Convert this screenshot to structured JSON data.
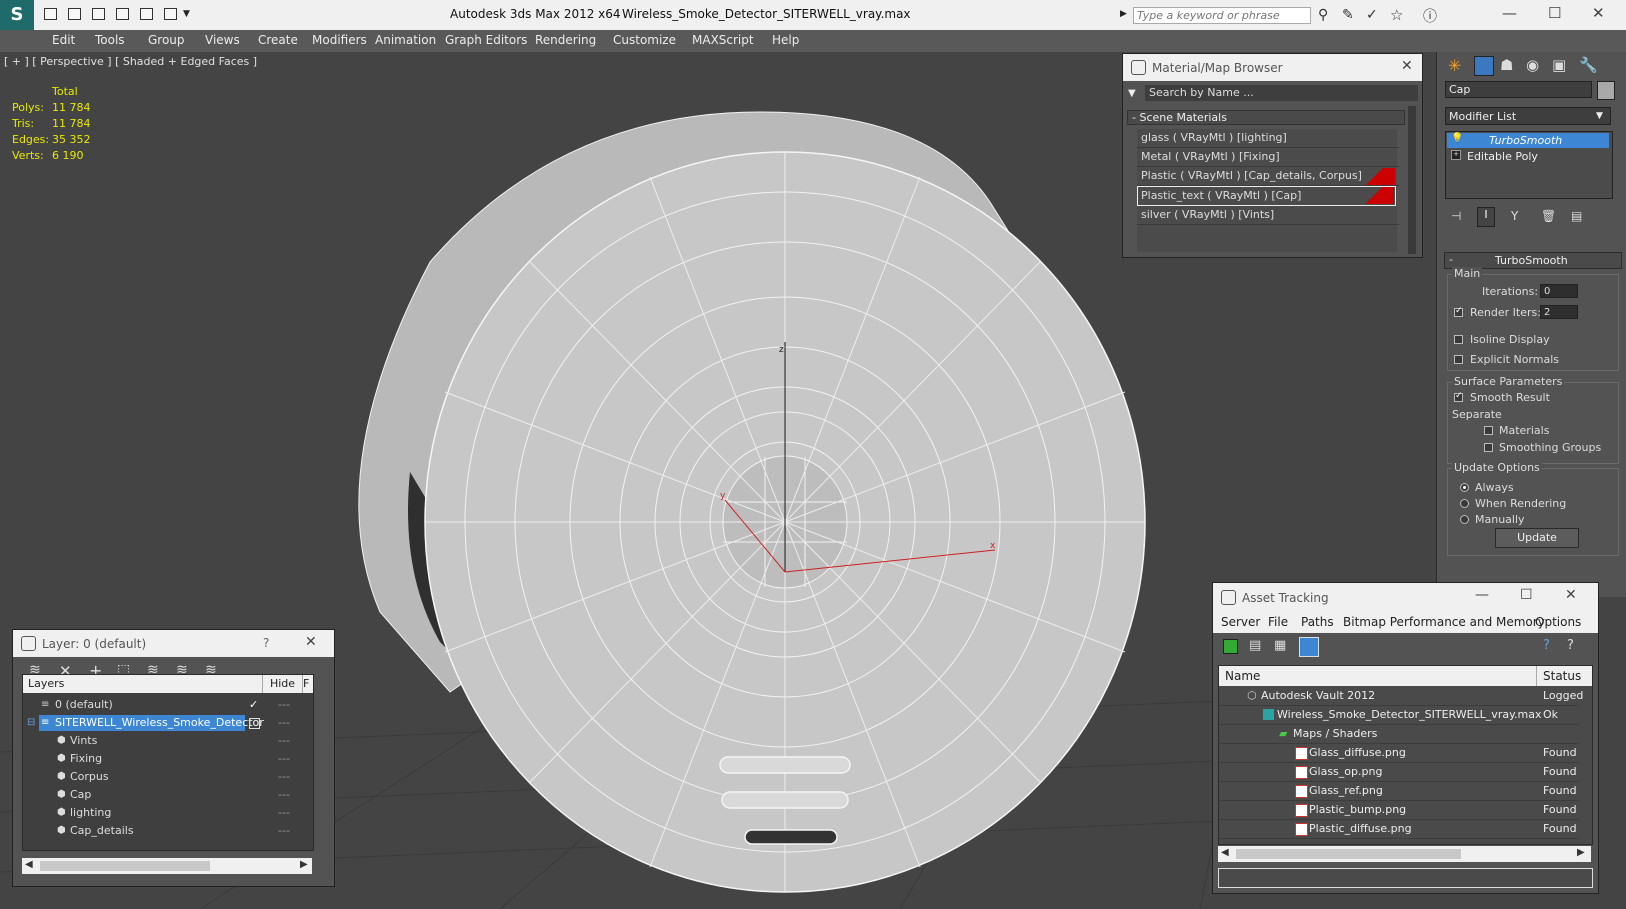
{
  "titlebar": {
    "app_title": "Autodesk 3ds Max  2012 x64",
    "file_name": "Wireless_Smoke_Detector_SITERWELL_vray.max",
    "search_placeholder": "Type a keyword or phrase",
    "minimize": "—",
    "maximize": "☐",
    "close": "✕"
  },
  "menu": [
    "Edit",
    "Tools",
    "Group",
    "Views",
    "Create",
    "Modifiers",
    "Animation",
    "Graph Editors",
    "Rendering",
    "Customize",
    "MAXScript",
    "Help"
  ],
  "viewport": {
    "label": "[ + ] [ Perspective ] [ Shaded + Edged Faces ]",
    "stats": {
      "header": "Total",
      "polys_label": "Polys:",
      "polys": "11 784",
      "tris_label": "Tris:",
      "tris": "11 784",
      "edges_label": "Edges:",
      "edges": "35 352",
      "verts_label": "Verts:",
      "verts": "6 190"
    },
    "gizmo": {
      "x": "x",
      "y": "y",
      "z": "z"
    }
  },
  "material_browser": {
    "title": "Material/Map Browser",
    "search_placeholder": "Search by Name ...",
    "section": "Scene Materials",
    "items": [
      {
        "label": "glass  ( VRayMtl ) [lighting]",
        "swatch": ""
      },
      {
        "label": "Metal  ( VRayMtl ) [Fixing]",
        "swatch": ""
      },
      {
        "label": "Plastic  ( VRayMtl ) [Cap_details, Corpus]",
        "swatch": "#cc0000"
      },
      {
        "label": "Plastic_text  ( VRayMtl ) [Cap]",
        "swatch": "#cc0000"
      },
      {
        "label": "silver  ( VRayMtl ) [Vints]",
        "swatch": ""
      }
    ]
  },
  "command_panel": {
    "object_name": "Cap",
    "modifier_list": "Modifier List",
    "stack": [
      "TurboSmooth",
      "Editable Poly"
    ],
    "rollout_title": "TurboSmooth",
    "main_group": "Main",
    "iterations_label": "Iterations:",
    "iterations": "0",
    "render_iters_label": "Render Iters:",
    "render_iters": "2",
    "isoline": "Isoline Display",
    "explicit_normals": "Explicit Normals",
    "surface_group": "Surface Parameters",
    "smooth_result": "Smooth Result",
    "separate": "Separate",
    "materials": "Materials",
    "smoothing_groups": "Smoothing Groups",
    "update_group": "Update Options",
    "always": "Always",
    "when_rendering": "When Rendering",
    "manually": "Manually",
    "update_btn": "Update"
  },
  "layer_panel": {
    "title": "Layer: 0 (default)",
    "help": "?",
    "close": "✕",
    "col_layers": "Layers",
    "col_hide": "Hide",
    "col_f": "F",
    "items": [
      {
        "label": "0 (default)",
        "indent": 1,
        "selected": false,
        "check": true
      },
      {
        "label": "SITERWELL_Wireless_Smoke_Detector",
        "indent": 1,
        "selected": true,
        "check": false
      },
      {
        "label": "Vints",
        "indent": 2,
        "selected": false,
        "check": false
      },
      {
        "label": "Fixing",
        "indent": 2,
        "selected": false,
        "check": false
      },
      {
        "label": "Corpus",
        "indent": 2,
        "selected": false,
        "check": false
      },
      {
        "label": "Cap",
        "indent": 2,
        "selected": false,
        "check": false
      },
      {
        "label": "lighting",
        "indent": 2,
        "selected": false,
        "check": false
      },
      {
        "label": "Cap_details",
        "indent": 2,
        "selected": false,
        "check": false
      }
    ]
  },
  "asset_tracking": {
    "title": "Asset Tracking",
    "menu": [
      "Server",
      "File",
      "Paths",
      "Bitmap Performance and Memory",
      "Options"
    ],
    "col_name": "Name",
    "col_status": "Status",
    "rows": [
      {
        "name": "Autodesk Vault 2012",
        "status": "Logged",
        "indent": 0
      },
      {
        "name": "Wireless_Smoke_Detector_SITERWELL_vray.max",
        "status": "Ok",
        "indent": 1
      },
      {
        "name": "Maps / Shaders",
        "status": "",
        "indent": 2
      },
      {
        "name": "Glass_diffuse.png",
        "status": "Found",
        "indent": 3
      },
      {
        "name": "Glass_op.png",
        "status": "Found",
        "indent": 3
      },
      {
        "name": "Glass_ref.png",
        "status": "Found",
        "indent": 3
      },
      {
        "name": "Plastic_bump.png",
        "status": "Found",
        "indent": 3
      },
      {
        "name": "Plastic_diffuse.png",
        "status": "Found",
        "indent": 3
      }
    ]
  }
}
